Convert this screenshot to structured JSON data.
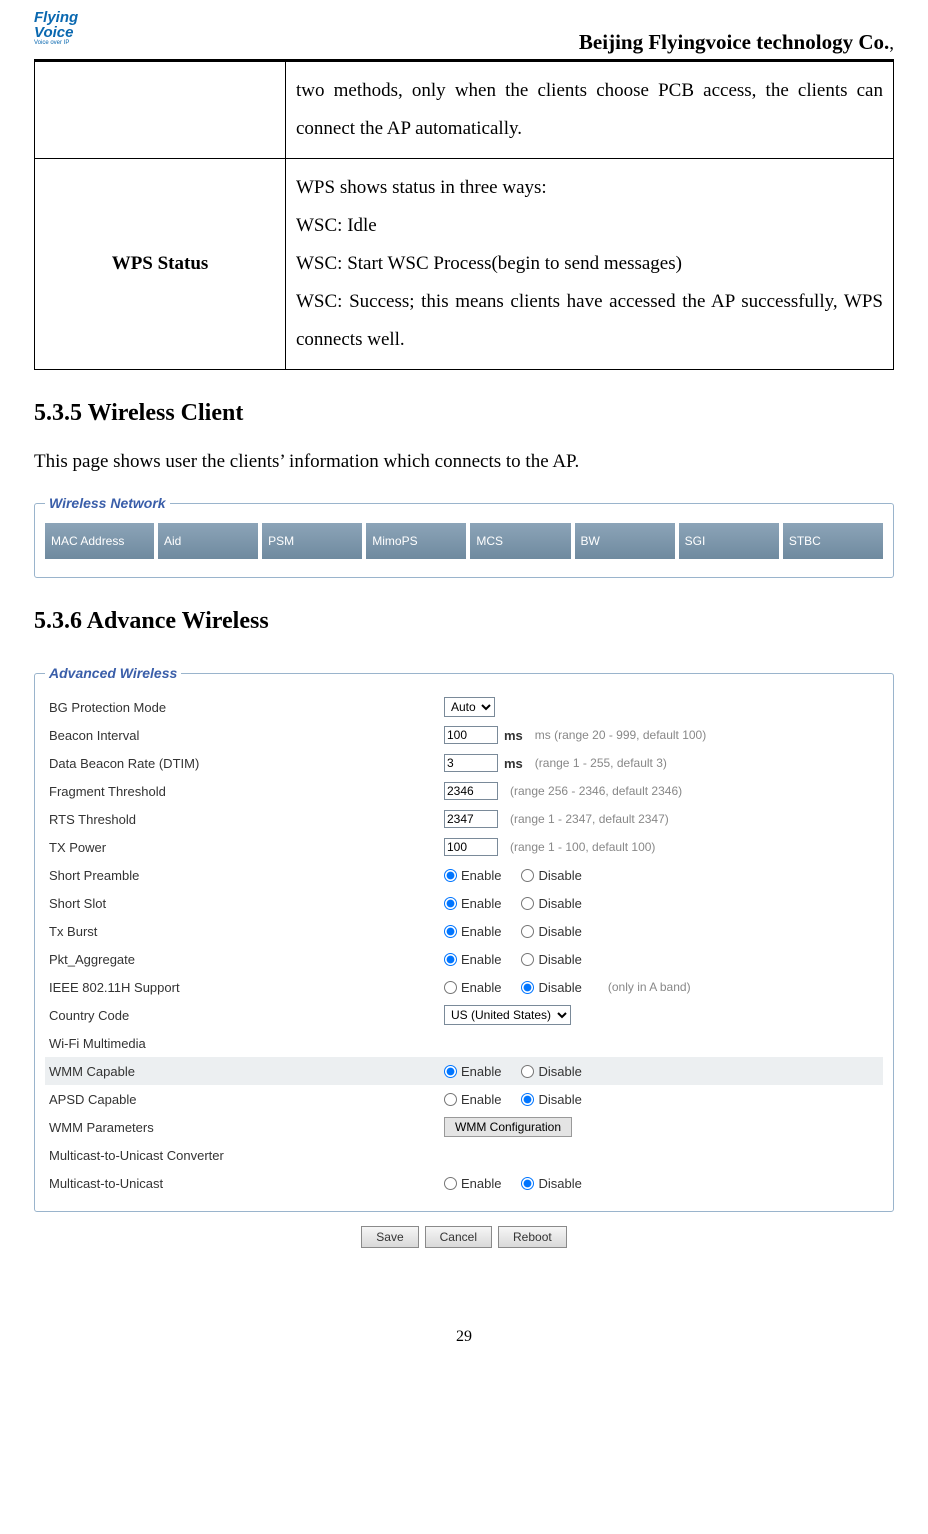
{
  "header": {
    "logo_top": "Flying",
    "logo_bottom": "Voice",
    "logo_tag": "Voice over IP",
    "company_main": "Beijing Flyingvoice technology Co.",
    "company_suffix": ","
  },
  "table": {
    "row1_desc_line": "two methods, only when the clients choose PCB access, the clients can connect the AP automatically.",
    "row2_label": "WPS Status",
    "row2_desc_l1": "WPS shows status in three ways:",
    "row2_desc_l2": "WSC: Idle",
    "row2_desc_l3": "WSC: Start WSC Process(begin to send messages)",
    "row2_desc_l4": "WSC: Success; this means clients have accessed the AP successfully, WPS connects well."
  },
  "section_535": {
    "heading": "5.3.5 Wireless Client",
    "intro": "This page shows user the clients’ information which connects to the AP.",
    "legend": "Wireless Network",
    "cols": [
      "MAC Address",
      "Aid",
      "PSM",
      "MimoPS",
      "MCS",
      "BW",
      "SGI",
      "STBC"
    ]
  },
  "section_536": {
    "heading": "5.3.6 Advance Wireless",
    "legend": "Advanced Wireless",
    "rows": {
      "bg_protection": {
        "label": "BG Protection Mode",
        "value": "Auto"
      },
      "beacon": {
        "label": "Beacon Interval",
        "value": "100",
        "hint_bold": "ms",
        "hint": " ms (range 20 - 999, default 100)"
      },
      "dtim": {
        "label": "Data Beacon Rate (DTIM)",
        "value": "3",
        "hint_bold": "ms",
        "hint": " (range 1 - 255, default 3)"
      },
      "frag": {
        "label": "Fragment Threshold",
        "value": "2346",
        "hint": "(range 256 - 2346, default 2346)"
      },
      "rts": {
        "label": "RTS Threshold",
        "value": "2347",
        "hint": "(range 1 - 2347, default 2347)"
      },
      "tx": {
        "label": "TX Power",
        "value": "100",
        "hint": "(range 1 - 100, default 100)"
      },
      "short_preamble": {
        "label": "Short Preamble",
        "selected": "Enable"
      },
      "short_slot": {
        "label": "Short Slot",
        "selected": "Enable"
      },
      "tx_burst": {
        "label": "Tx Burst",
        "selected": "Enable"
      },
      "pkt_agg": {
        "label": "Pkt_Aggregate",
        "selected": "Enable"
      },
      "ieee": {
        "label": "IEEE 802.11H Support",
        "selected": "Disable",
        "hint": "(only in A band)"
      },
      "country": {
        "label": "Country Code",
        "value": "US (United States)"
      },
      "wifi_mm": {
        "label": "Wi-Fi Multimedia"
      },
      "wmm_cap": {
        "label": "WMM Capable",
        "selected": "Enable"
      },
      "apsd": {
        "label": "APSD Capable",
        "selected": "Disable"
      },
      "wmm_params": {
        "label": "WMM Parameters",
        "btn": "WMM Configuration"
      },
      "m2u_conv": {
        "label": "Multicast-to-Unicast Converter"
      },
      "m2u": {
        "label": "Multicast-to-Unicast",
        "selected": "Disable"
      }
    },
    "radio_labels": {
      "enable": "Enable",
      "disable": "Disable"
    },
    "buttons": {
      "save": "Save",
      "cancel": "Cancel",
      "reboot": "Reboot"
    }
  },
  "page_number": "29"
}
